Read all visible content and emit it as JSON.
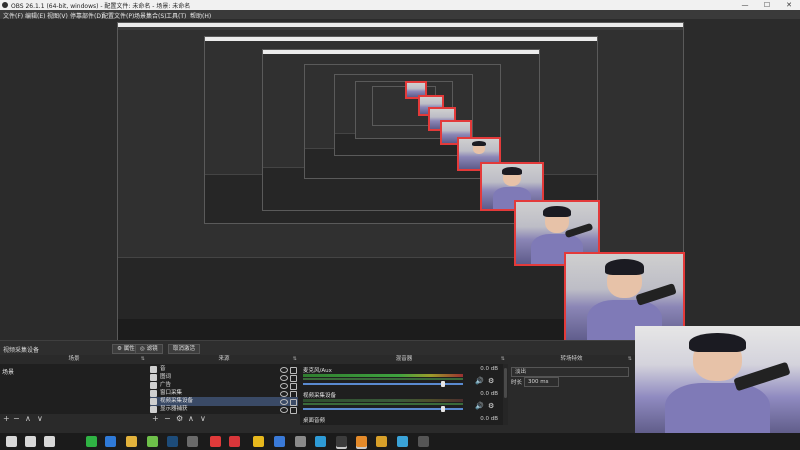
{
  "window": {
    "title": "OBS 26.1.1 (64-bit, windows) - 配置文件: 未命名 - 场景: 未命名",
    "controls": {
      "minimize": "—",
      "maximize": "☐",
      "close": "✕"
    }
  },
  "menu": [
    "文件(F)",
    "编辑(E)",
    "视图(V)",
    "停靠部件(D)",
    "配置文件(P)",
    "场景集合(S)",
    "工具(T)",
    "帮助(H)"
  ],
  "status": {
    "source_label": "视频采集设备",
    "properties_label": "属性",
    "filters_label": "滤镜",
    "deactivate_label": "取消激活"
  },
  "scenes": {
    "header": "场景",
    "items": [
      "场景"
    ]
  },
  "sources": {
    "header": "来源",
    "items": [
      {
        "label": "音",
        "icon": "text-icon"
      },
      {
        "label": "图词",
        "icon": "image-icon"
      },
      {
        "label": "广告",
        "icon": "image-icon"
      },
      {
        "label": "窗口采集",
        "icon": "window-icon"
      },
      {
        "label": "视频采集设备",
        "icon": "camera-icon"
      },
      {
        "label": "显示器捕获",
        "icon": "monitor-icon"
      }
    ]
  },
  "mixer": {
    "header": "混音器",
    "channels": [
      {
        "name": "麦克风/Aux",
        "db": "0.0 dB",
        "level": 0.86
      },
      {
        "name": "视频采集设备",
        "db": "0.0 dB",
        "level": 0.86
      },
      {
        "name": "桌面音频",
        "db": "0.0 dB",
        "level": 0.86
      }
    ]
  },
  "transitions": {
    "header": "转场特效",
    "selected": "淡出",
    "duration_label": "时长",
    "duration_value": "300 ms"
  },
  "footer_buttons": {
    "add": "+",
    "remove": "−",
    "up": "∧",
    "down": "∨",
    "gear": "⚙"
  },
  "dock_menu_glyph": "⇅",
  "taskbar": {
    "icons": [
      {
        "name": "windows-start-icon",
        "color": "#d8d8d8"
      },
      {
        "name": "search-icon",
        "color": "#d8d8d8"
      },
      {
        "name": "task-view-icon",
        "color": "#d8d8d8"
      },
      {
        "name": "wechat-icon",
        "color": "#2fb344"
      },
      {
        "name": "chat-icon",
        "color": "#2f7ad8"
      },
      {
        "name": "file-explorer-icon",
        "color": "#e2b23c"
      },
      {
        "name": "green-app-icon",
        "color": "#6ec04a"
      },
      {
        "name": "steam-icon",
        "color": "#1d4c7a"
      },
      {
        "name": "game-icon",
        "color": "#6a6a6a"
      },
      {
        "name": "red-app-icon",
        "color": "#e03a3a"
      },
      {
        "name": "netease-music-icon",
        "color": "#d8363a"
      },
      {
        "name": "yellow-ring-icon",
        "color": "#e7b81d"
      },
      {
        "name": "blue-app-icon",
        "color": "#3a7ad8"
      },
      {
        "name": "gear-app-icon",
        "color": "#8a8a8a"
      },
      {
        "name": "phone-app-icon",
        "color": "#2e9bd6"
      },
      {
        "name": "obs-icon",
        "color": "#3c3c3c"
      },
      {
        "name": "orange-app-icon",
        "color": "#e38a2a"
      },
      {
        "name": "video-app-icon",
        "color": "#d8a02a"
      },
      {
        "name": "chart-app-icon",
        "color": "#3aa3d8"
      },
      {
        "name": "obs-active-icon",
        "color": "#555555"
      }
    ]
  }
}
